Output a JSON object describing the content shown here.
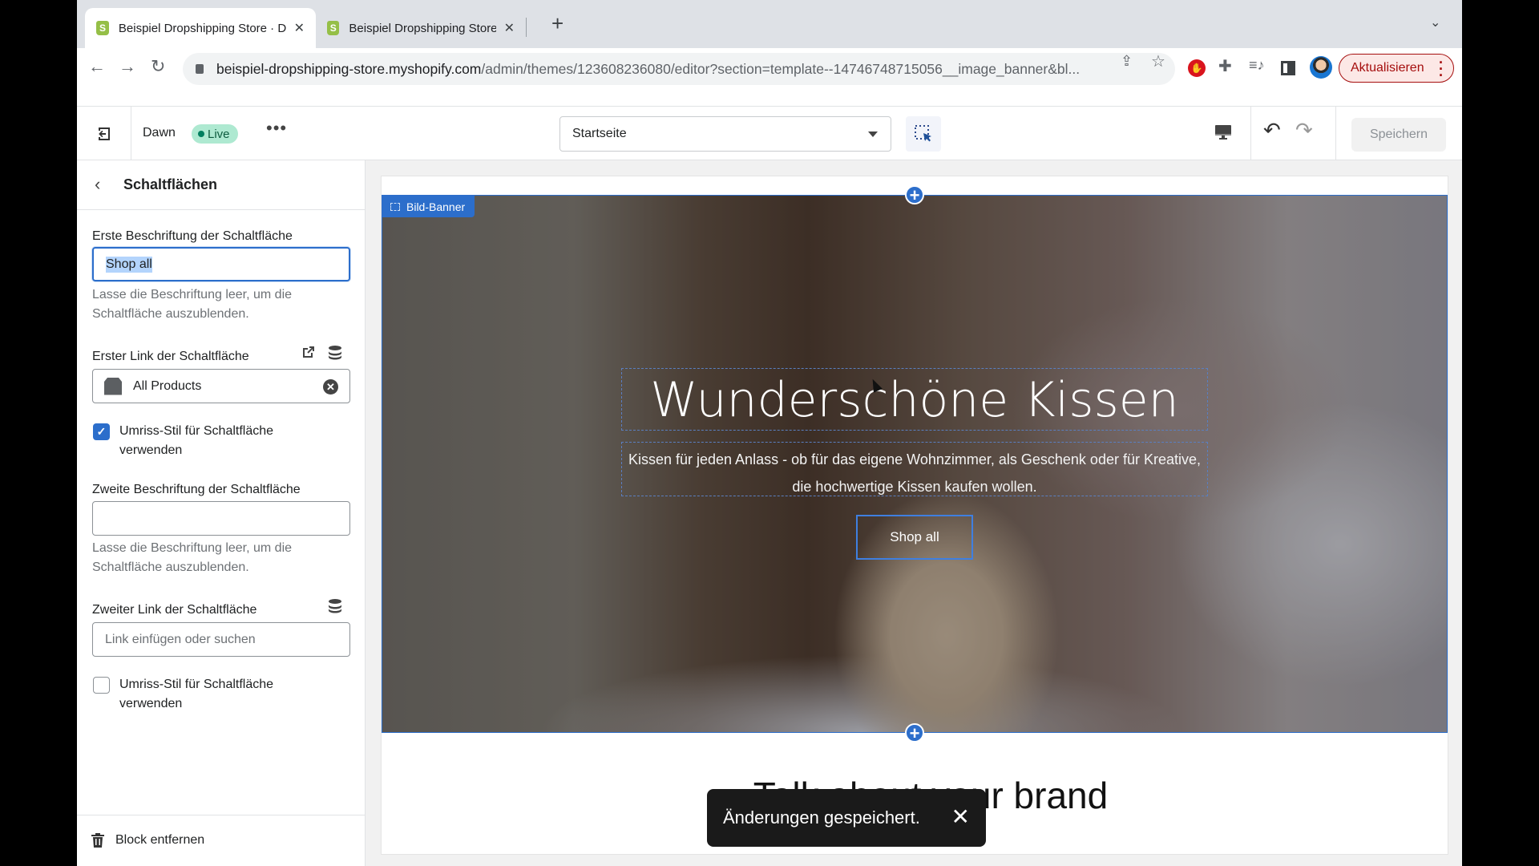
{
  "browser": {
    "tabs": [
      {
        "title": "Beispiel Dropshipping Store · D",
        "active": true
      },
      {
        "title": "Beispiel Dropshipping Store · E",
        "active": false
      }
    ],
    "url_host": "beispiel-dropshipping-store.myshopify.com",
    "url_path": "/admin/themes/123608236080/editor?section=template--14746748715056__image_banner&bl...",
    "update_button": "Aktualisieren",
    "icons": {
      "back": "←",
      "forward": "→",
      "reload": "↻",
      "share": "⇪",
      "star": "☆",
      "new_tab": "+",
      "tab_list": "⌄",
      "close": "✕",
      "puzzle": "✚",
      "media": "≡♪",
      "stop": "✋"
    }
  },
  "editor": {
    "theme_name": "Dawn",
    "status_badge": "Live",
    "more": "•••",
    "page_select": "Startseite",
    "undo": "↶",
    "redo": "↷",
    "save_label": "Speichern"
  },
  "sidebar": {
    "back": "‹",
    "title": "Schaltflächen",
    "first_label": {
      "label": "Erste Beschriftung der Schaltfläche",
      "value": "Shop all",
      "help": "Lasse die Beschriftung leer, um die Schaltfläche auszublenden."
    },
    "first_link": {
      "label": "Erster Link der Schaltfläche",
      "value": "All Products"
    },
    "first_outline": {
      "label": "Umriss-Stil für Schaltfläche verwenden",
      "checked": true
    },
    "second_label": {
      "label": "Zweite Beschriftung der Schaltfläche",
      "value": "",
      "help": "Lasse die Beschriftung leer, um die Schaltfläche auszublenden."
    },
    "second_link": {
      "label": "Zweiter Link der Schaltfläche",
      "placeholder": "Link einfügen oder suchen"
    },
    "second_outline": {
      "label": "Umriss-Stil für Schaltfläche verwenden",
      "checked": false
    },
    "remove_block": "Block entfernen",
    "check_mark": "✓",
    "clear": "✕"
  },
  "preview": {
    "section_badge": "Bild-Banner",
    "heading": "Wunderschöne Kissen",
    "subtext": "Kissen für jeden Anlass - ob für das eigene Wohnzimmer, als Geschenk oder für Kreative, die hochwertige Kissen kaufen wollen.",
    "button": "Shop all",
    "add_section": "+",
    "next_heading": "Talk about your brand"
  },
  "toast": {
    "message": "Änderungen gespeichert.",
    "close": "✕"
  },
  "colors": {
    "accent": "#2c6ecb",
    "live_badge": "#aee9d1",
    "update_button": "#a50e0e",
    "toast_bg": "#1a1a1a"
  }
}
